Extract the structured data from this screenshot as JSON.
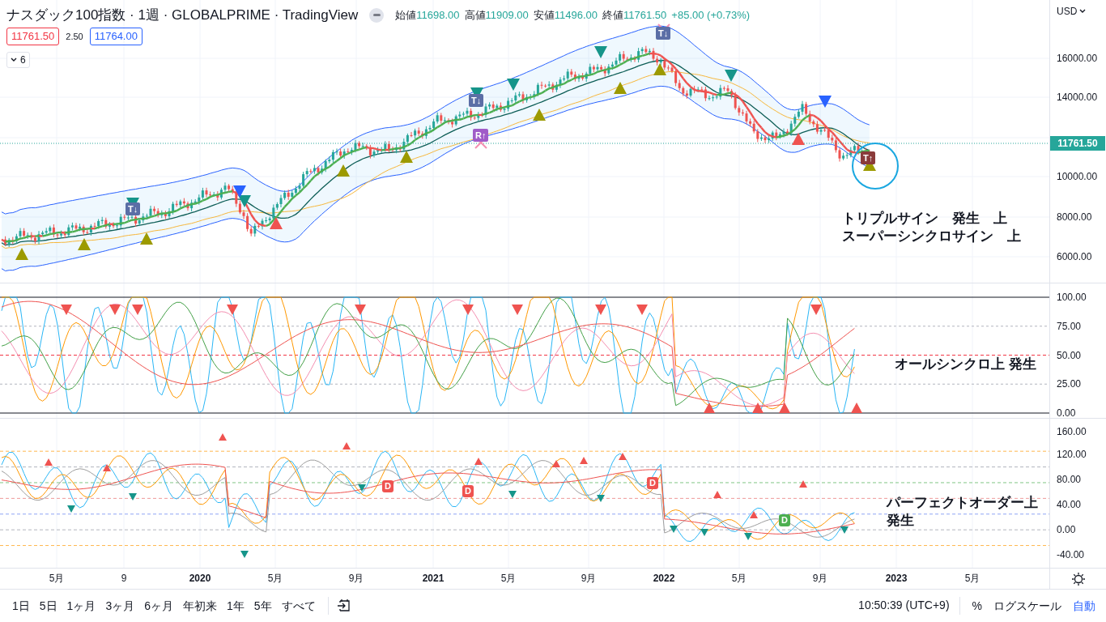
{
  "header": {
    "title": "ナスダック100指数 · 1週 · GLOBALPRIME · TradingView",
    "ohlc": [
      {
        "label": "始値",
        "value": "11698.00"
      },
      {
        "label": "高値",
        "value": "11909.00"
      },
      {
        "label": "安値",
        "value": "11496.00"
      },
      {
        "label": "終値",
        "value": "11761.50"
      }
    ],
    "change": "+85.00 (+0.73%)"
  },
  "quote": {
    "bid": "11761.50",
    "spread": "2.50",
    "ask": "11764.00"
  },
  "indicators_toggle": {
    "count": "6"
  },
  "price_axis": {
    "currency": "USD",
    "ticks": [
      "16000.00",
      "14000.00",
      "10000.00",
      "8000.00",
      "6000.00"
    ],
    "last_price": "11761.50"
  },
  "oscillator_axis": {
    "ticks": [
      "100.00",
      "75.00",
      "50.00",
      "25.00",
      "0.00"
    ]
  },
  "order_axis": {
    "ticks": [
      "160.00",
      "120.00",
      "80.00",
      "40.00",
      "0.00",
      "-40.00"
    ]
  },
  "signal_badges": [
    {
      "label": "T↓",
      "color": "#5b6ea6"
    },
    {
      "label": "T↓",
      "color": "#5b6ea6"
    },
    {
      "label": "R↑",
      "color": "#a05cc8"
    },
    {
      "label": "T↓",
      "color": "#5b6ea6"
    },
    {
      "label": "T↑",
      "color": "#8a3b3b"
    }
  ],
  "order_badges": [
    {
      "label": "D",
      "color": "#ef5350"
    },
    {
      "label": "D",
      "color": "#ef5350"
    },
    {
      "label": "D",
      "color": "#ef5350"
    },
    {
      "label": "D",
      "color": "#4caf50"
    }
  ],
  "annotations": [
    {
      "lines": [
        "トリプルサイン　発生　上",
        "スーパーシンクロサイン　上"
      ]
    },
    {
      "lines": [
        "オールシンクロ上 発生"
      ]
    },
    {
      "lines": [
        "パーフェクトオーダー上",
        "発生"
      ]
    }
  ],
  "time_axis": {
    "labels": [
      "5月",
      "9",
      "2020",
      "5月",
      "9月",
      "2021",
      "5月",
      "9月",
      "2022",
      "5月",
      "9月",
      "2023",
      "5月"
    ]
  },
  "bottom_bar": {
    "ranges": [
      "1日",
      "5日",
      "1ヶ月",
      "3ヶ月",
      "6ヶ月",
      "年初来",
      "1年",
      "5年",
      "すべて"
    ],
    "time": "10:50:39 (UTC+9)",
    "scale_options": [
      {
        "label": "%",
        "selected": false
      },
      {
        "label": "ログスケール",
        "selected": false
      },
      {
        "label": "自動",
        "selected": true
      }
    ]
  }
}
